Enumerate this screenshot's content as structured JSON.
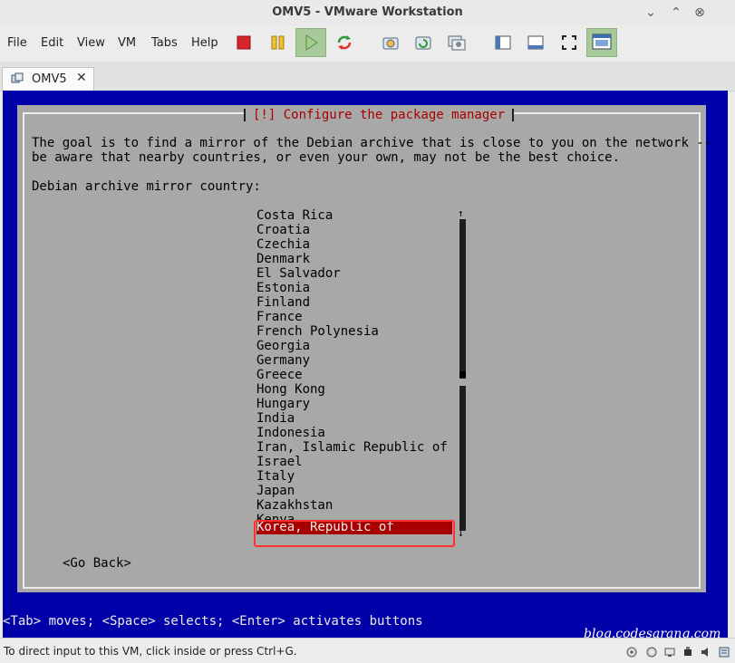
{
  "window": {
    "title": "OMV5 - VMware Workstation",
    "controls": [
      "⌄",
      "⌃",
      "⊗"
    ]
  },
  "menu": [
    "File",
    "Edit",
    "View",
    "VM",
    "Tabs",
    "Help"
  ],
  "tab": {
    "label": "OMV5",
    "close": "✕"
  },
  "installer": {
    "title": "[!] Configure the package manager",
    "description_line1": "The goal is to find a mirror of the Debian archive that is close to you on the network --",
    "description_line2": "be aware that nearby countries, or even your own, may not be the best choice.",
    "prompt": "Debian archive mirror country:",
    "countries": [
      "Costa Rica",
      "Croatia",
      "Czechia",
      "Denmark",
      "El Salvador",
      "Estonia",
      "Finland",
      "France",
      "French Polynesia",
      "Georgia",
      "Germany",
      "Greece",
      "Hong Kong",
      "Hungary",
      "India",
      "Indonesia",
      "Iran, Islamic Republic of",
      "Israel",
      "Italy",
      "Japan",
      "Kazakhstan",
      "Kenya"
    ],
    "selected": "Korea, Republic of",
    "go_back": "<Go Back>",
    "help_line": "<Tab> moves; <Space> selects; <Enter> activates buttons"
  },
  "watermark": "blog.codesarang.com",
  "status": {
    "message": "To direct input to this VM, click inside or press Ctrl+G."
  },
  "colors": {
    "console_blue": "#0000a8",
    "dialog_gray": "#a8a8a8",
    "selection_red": "#a80000",
    "highlight_border": "#ff3030"
  }
}
